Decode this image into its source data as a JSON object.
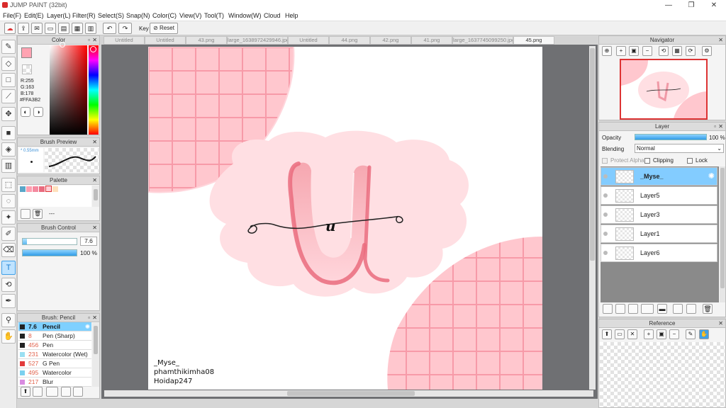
{
  "window": {
    "title": "JUMP PAINT (32bit)",
    "controls": [
      "—",
      "❐",
      "✕"
    ]
  },
  "menu": [
    "File(F)",
    "Edit(E)",
    "Layer(L)",
    "Filter(R)",
    "Select(S)",
    "Snap(N)",
    "Color(C)",
    "View(V)",
    "Tool(T)",
    "Window(W)",
    "Cloud",
    "Help"
  ],
  "toolbar": {
    "key_label": "Key",
    "reset_label": "Reset"
  },
  "tabs": [
    "Untitled",
    "Untitled",
    "43.png",
    "large_1638972429946.jpg",
    "Untitled",
    "44.png",
    "42.png",
    "41.png",
    "large_1637745099250.jpg",
    "45.png"
  ],
  "active_tab": 9,
  "color_panel": {
    "title": "Color",
    "r": "R:255",
    "g": "G:163",
    "b": "B:178",
    "hex": "#FFA3B2",
    "current_color": "#ffa3b2"
  },
  "brush_preview": {
    "title": "Brush Preview",
    "size": "* 0.55mm"
  },
  "palette": {
    "title": "Palette",
    "swatches": [
      "#5aa6c8",
      "#ff9fb0",
      "#f48aa0",
      "#e96b7e",
      "#ffd0d8",
      "#ffe1bd"
    ],
    "footer": "---"
  },
  "brush_control": {
    "title": "Brush Control",
    "size_value": "7.6",
    "size_fill": 0.08,
    "opacity_value": "100 %",
    "opacity_fill": 1.0
  },
  "brush_list": {
    "title": "Brush: Pencil",
    "items": [
      {
        "size": "7.6",
        "name": "Pencil",
        "color": "#222222",
        "selected": true
      },
      {
        "size": "8",
        "name": "Pen (Sharp)",
        "color": "#222222",
        "selected": false
      },
      {
        "size": "456",
        "name": "Pen",
        "color": "#222222",
        "selected": false
      },
      {
        "size": "231",
        "name": "Watercolor (Wet)",
        "color": "#9adff2",
        "selected": false
      },
      {
        "size": "527",
        "name": "G Pen",
        "color": "#e23b3b",
        "selected": false
      },
      {
        "size": "495",
        "name": "Watercolor",
        "color": "#7bd0ef",
        "selected": false
      },
      {
        "size": "217",
        "name": "Blur",
        "color": "#d98be0",
        "selected": false
      }
    ]
  },
  "navigator": {
    "title": "Navigator"
  },
  "layer_panel": {
    "title": "Layer",
    "opacity_label": "Opacity",
    "opacity_value": "100 %",
    "opacity_fill": 1.0,
    "blending_label": "Blending",
    "blending_value": "Normal",
    "protect_alpha": "Protect Alpha",
    "clipping": "Clipping",
    "lock": "Lock",
    "layers": [
      {
        "name": "_Myse_",
        "selected": true
      },
      {
        "name": "Layer5",
        "selected": false
      },
      {
        "name": "Layer3",
        "selected": false
      },
      {
        "name": "Layer1",
        "selected": false
      },
      {
        "name": "Layer6",
        "selected": false
      }
    ]
  },
  "reference": {
    "title": "Reference"
  },
  "artwork": {
    "letter": "u",
    "signature_lines": [
      "_Myse_",
      "phamthikimha08",
      "Hoidap247"
    ],
    "colors": {
      "pink_light": "#ffdfe3",
      "pink_grid": "#ffc2ca",
      "pink_line": "#f58e9c",
      "letter_main": "#f4a0aa",
      "letter_dark": "#ea6c7e"
    }
  }
}
